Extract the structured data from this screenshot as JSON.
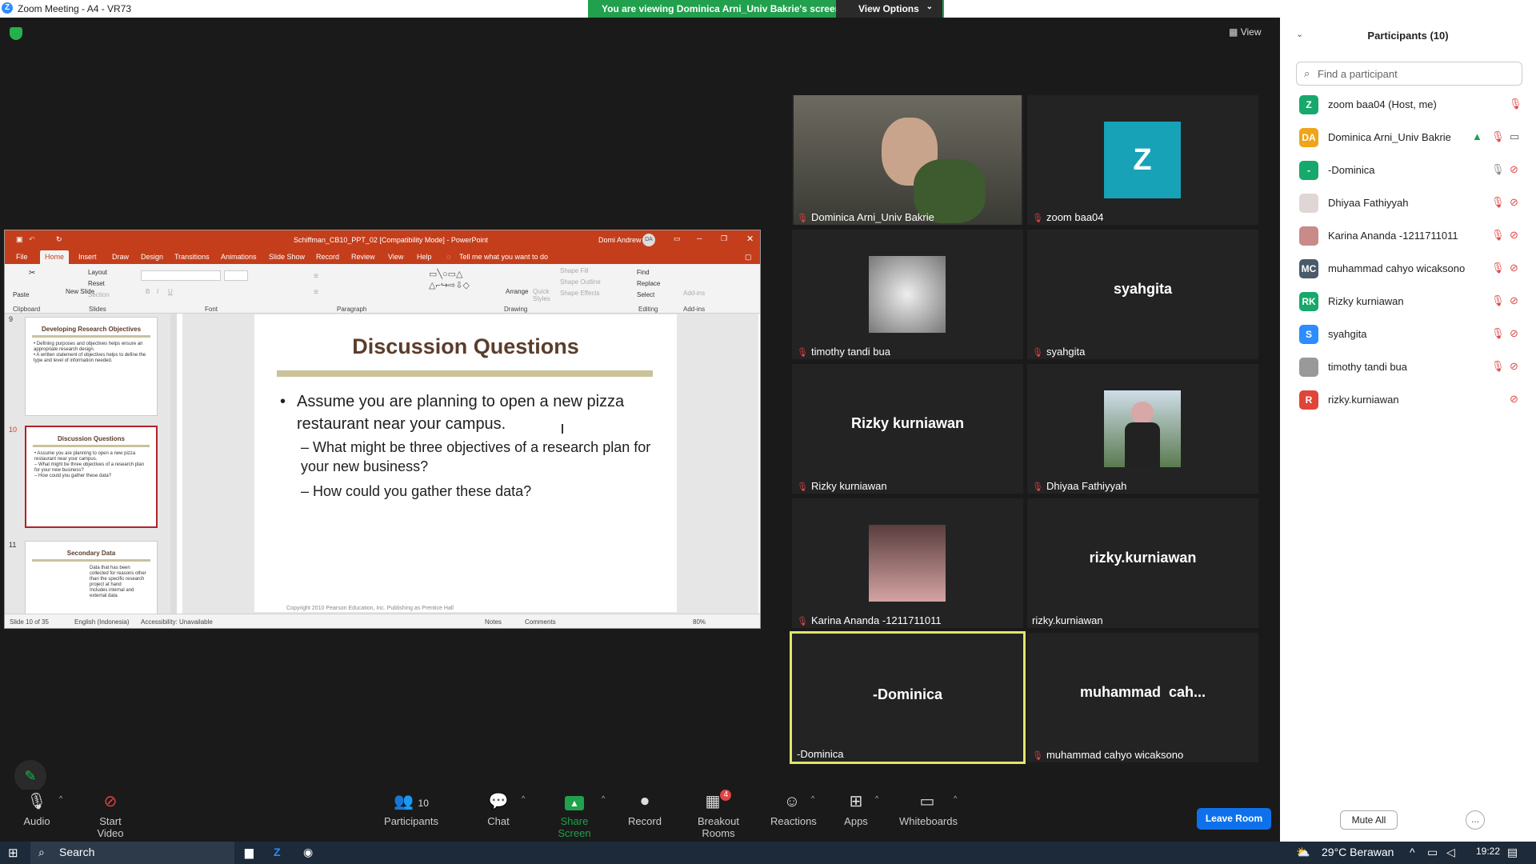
{
  "window": {
    "title": "Zoom Meeting - A4 - VR73"
  },
  "banner": {
    "text": "You are viewing Dominica Arni_Univ Bakrie's screen",
    "view_options": "View Options"
  },
  "view_btn": "View",
  "ppt": {
    "title": "Schiffman_CB10_PPT_02 [Compatibility Mode] - PowerPoint",
    "user": "Domi Andrew",
    "user_initials": "DA",
    "tabs": [
      "File",
      "Home",
      "Insert",
      "Draw",
      "Design",
      "Transitions",
      "Animations",
      "Slide Show",
      "Record",
      "Review",
      "View",
      "Help"
    ],
    "tell_me": "Tell me what you want to do",
    "groups": [
      "Clipboard",
      "Slides",
      "Font",
      "Paragraph",
      "Drawing",
      "Editing",
      "Add-ins"
    ],
    "ribbon": {
      "paste": "Paste",
      "new_slide": "New Slide",
      "layout": "Layout",
      "reset": "Reset",
      "section": "Section",
      "arrange": "Arrange",
      "quick_styles": "Quick Styles",
      "shape_fill": "Shape Fill",
      "shape_outline": "Shape Outline",
      "shape_effects": "Shape Effects",
      "find": "Find",
      "replace": "Replace",
      "select": "Select",
      "addins": "Add-ins"
    },
    "thumbs": [
      {
        "num": "9",
        "title": "Developing Research Objectives",
        "body": "• Defining purposes and objectives helps ensure an appropriate research design.\n• A written statement of objectives helps to define the type and level of information needed."
      },
      {
        "num": "10",
        "title": "Discussion Questions",
        "body": "• Assume you are planning to open a new pizza restaurant near your campus.\n – What might be three objectives of a research plan for your new business?\n – How could you gather these data?"
      },
      {
        "num": "11",
        "title": "Secondary Data",
        "body": "Data that has been collected for reasons other than the specific research project at hand\nIncludes internal and external data"
      }
    ],
    "slide": {
      "title": "Discussion Questions",
      "bullet1": "Assume you are planning to open a new pizza restaurant near your campus.",
      "sub1": "– What might be three objectives of a research plan for your new business?",
      "sub2": "– How could you gather these data?",
      "footer": "Copyright 2010 Pearson Education, Inc. Publishing as Prentice Hall"
    },
    "status": {
      "slide": "Slide 10 of 35",
      "lang": "English (Indonesia)",
      "access": "Accessibility: Unavailable",
      "notes": "Notes",
      "comments": "Comments",
      "zoom": "80%"
    }
  },
  "tiles": [
    {
      "name": "Dominica Arni_Univ Bakrie",
      "type": "video",
      "muted": true
    },
    {
      "name": "zoom baa04",
      "type": "letter",
      "letter": "Z",
      "color": "#17a2b8",
      "muted": true
    },
    {
      "name": "timothy tandi bua",
      "type": "statue",
      "muted": true
    },
    {
      "name": "syahgita",
      "type": "text",
      "muted": true
    },
    {
      "name": "Rizky kurniawan",
      "type": "text",
      "muted": true
    },
    {
      "name": "Dhiyaa Fathiyyah",
      "type": "photo",
      "muted": true
    },
    {
      "name": "Karina Ananda -1211711011",
      "type": "photo2",
      "muted": true
    },
    {
      "name": "rizky.kurniawan",
      "type": "text",
      "muted": false
    },
    {
      "name": "-Dominica",
      "type": "text",
      "muted": false,
      "active": true
    },
    {
      "name": "muhammad cahyo wicaksono",
      "big": "muhammad  cah...",
      "type": "text",
      "muted": true
    }
  ],
  "panel": {
    "title": "Participants (10)",
    "search_placeholder": "Find a participant",
    "participants": [
      {
        "name": "zoom baa04 (Host, me)",
        "initials": "Z",
        "color": "#17a86b",
        "mic": "off",
        "cam": "none"
      },
      {
        "name": "Dominica Arni_Univ Bakrie",
        "initials": "DA",
        "color": "#f0a41a",
        "mic": "off",
        "cam": "on",
        "sharing": true
      },
      {
        "name": "-Dominica",
        "initials": "-",
        "color": "#17a86b",
        "mic": "on",
        "cam": "off"
      },
      {
        "name": "Dhiyaa Fathiyyah",
        "initials": "",
        "color": "#e0d6d6",
        "mic": "off",
        "cam": "off"
      },
      {
        "name": "Karina Ananda -1211711011",
        "initials": "",
        "color": "#c98a8a",
        "mic": "off",
        "cam": "off"
      },
      {
        "name": "muhammad cahyo wicaksono",
        "initials": "MC",
        "color": "#4a5a6a",
        "mic": "off",
        "cam": "off"
      },
      {
        "name": "Rizky kurniawan",
        "initials": "RK",
        "color": "#17a86b",
        "mic": "off",
        "cam": "off"
      },
      {
        "name": "syahgita",
        "initials": "S",
        "color": "#2d8cff",
        "mic": "off",
        "cam": "off"
      },
      {
        "name": "timothy tandi bua",
        "initials": "",
        "color": "#999",
        "mic": "off",
        "cam": "off"
      },
      {
        "name": "rizky.kurniawan",
        "initials": "R",
        "color": "#e0453a",
        "mic": "none",
        "cam": "off"
      }
    ],
    "mute_all": "Mute All",
    "more": "..."
  },
  "toolbar": {
    "audio": "Audio",
    "start_video": "Start Video",
    "participants": "Participants",
    "participants_count": "10",
    "chat": "Chat",
    "share_screen": "Share Screen",
    "record": "Record",
    "breakout": "Breakout Rooms",
    "breakout_badge": "4",
    "reactions": "Reactions",
    "apps": "Apps",
    "whiteboards": "Whiteboards",
    "leave_room": "Leave Room"
  },
  "taskbar": {
    "search": "Search",
    "weather": "29°C  Berawan",
    "time": "19:22"
  }
}
